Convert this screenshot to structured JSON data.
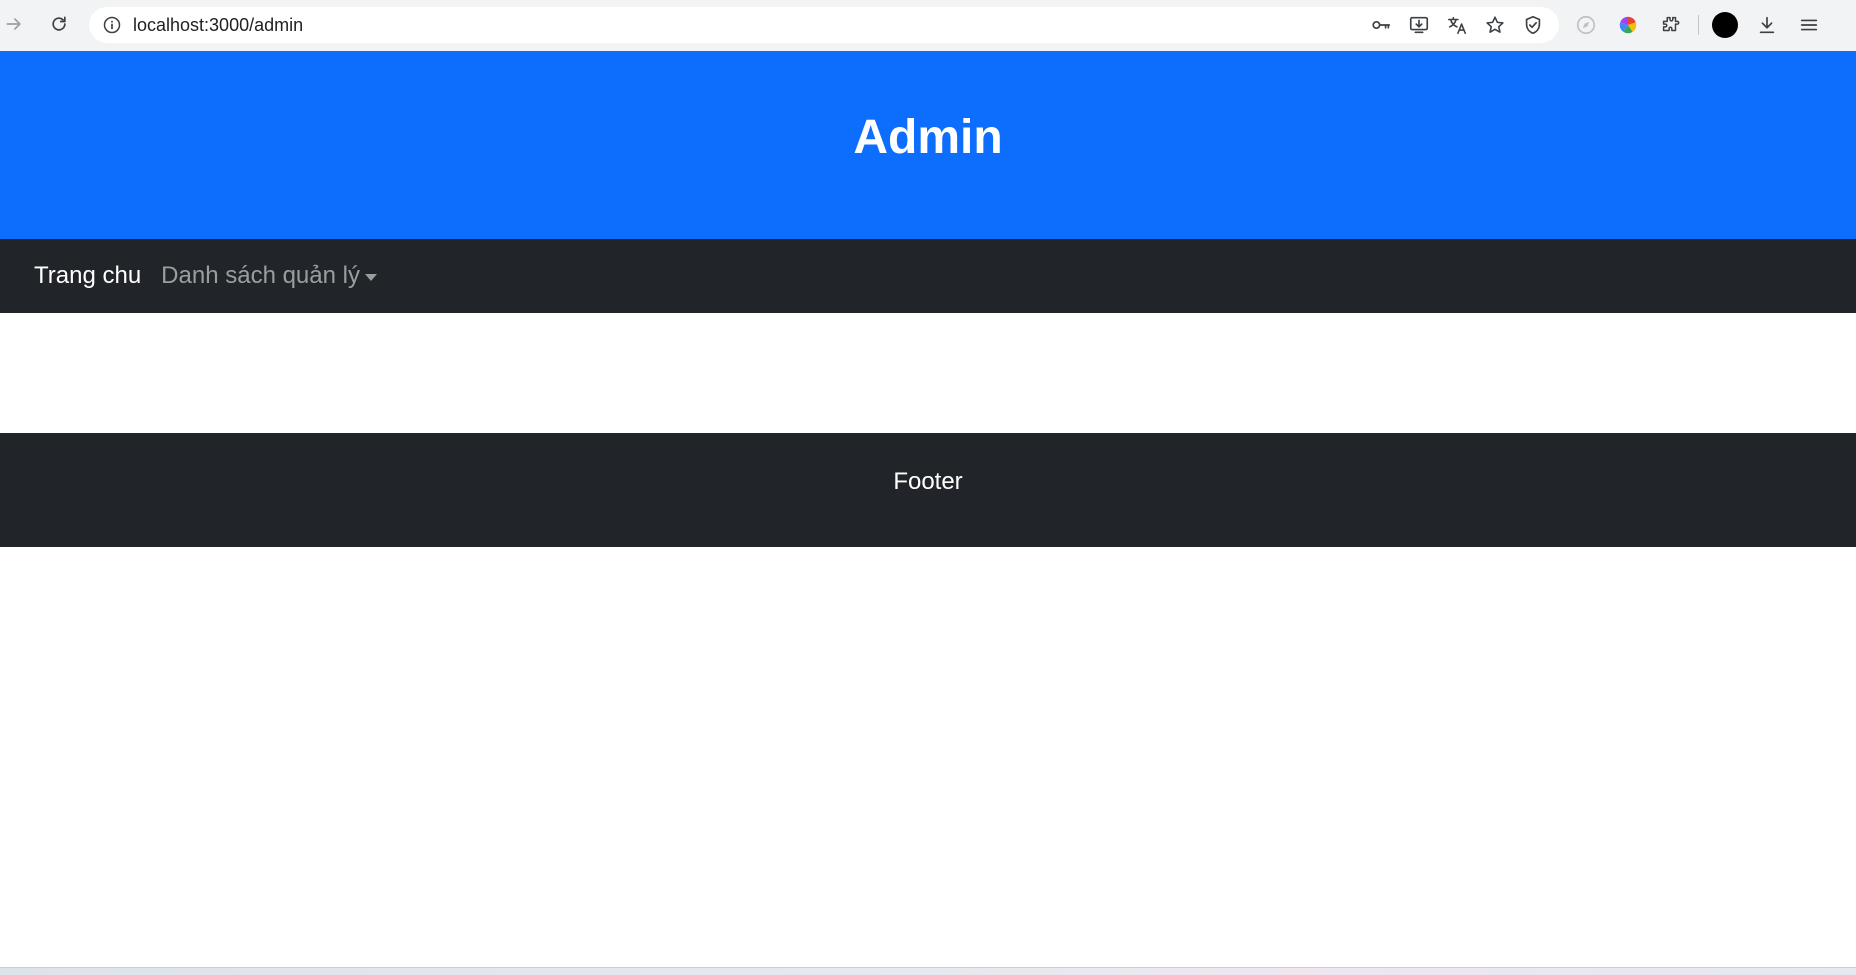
{
  "browser": {
    "url": "localhost:3000/admin"
  },
  "page": {
    "hero_title": "Admin",
    "navbar": {
      "home_label": "Trang chu",
      "dropdown_label": "Danh sách quản lý"
    },
    "footer_text": "Footer"
  },
  "colors": {
    "hero_bg": "#0d6efd",
    "navbar_bg": "#212529",
    "footer_bg": "#212529"
  }
}
